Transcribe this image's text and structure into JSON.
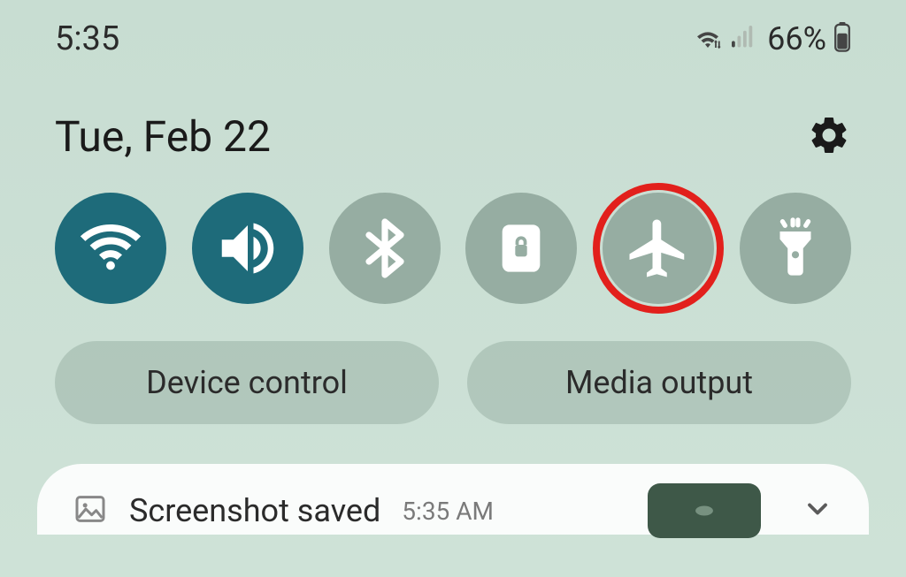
{
  "status": {
    "time": "5:35",
    "battery": "66%"
  },
  "date": "Tue, Feb 22",
  "toggles": [
    {
      "name": "wifi",
      "active": true
    },
    {
      "name": "sound",
      "active": true
    },
    {
      "name": "bluetooth",
      "active": false
    },
    {
      "name": "rotation-lock",
      "active": false
    },
    {
      "name": "airplane",
      "active": false,
      "highlighted": true
    },
    {
      "name": "flashlight",
      "active": false
    }
  ],
  "quickButtons": {
    "device": "Device control",
    "media": "Media output"
  },
  "notification": {
    "title": "Screenshot saved",
    "time": "5:35 AM"
  }
}
